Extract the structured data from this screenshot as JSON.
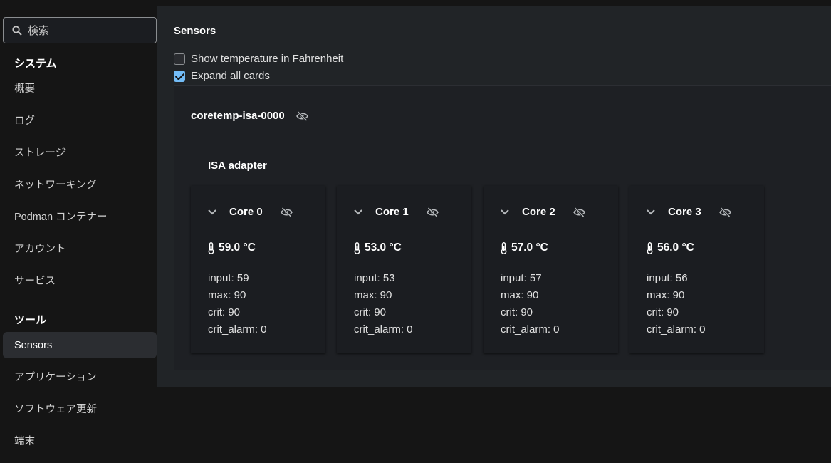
{
  "sidebar": {
    "search_placeholder": "検索",
    "sections": [
      {
        "heading": "システム",
        "items": [
          "概要",
          "ログ",
          "ストレージ",
          "ネットワーキング",
          "Podman コンテナー",
          "アカウント",
          "サービス"
        ]
      },
      {
        "heading": "ツール",
        "items": [
          "Sensors",
          "アプリケーション",
          "ソフトウェア更新",
          "端末"
        ]
      }
    ],
    "active_item": "Sensors"
  },
  "main": {
    "title": "Sensors",
    "options": [
      {
        "label": "Show temperature in Fahrenheit",
        "checked": false
      },
      {
        "label": "Expand all cards",
        "checked": true
      }
    ],
    "chip": {
      "name": "coretemp-isa-0000",
      "adapter": "ISA adapter",
      "cores": [
        {
          "name": "Core 0",
          "temp": "59.0 °C",
          "input": "input: 59",
          "max": "max: 90",
          "crit": "crit: 90",
          "crit_alarm": "crit_alarm: 0"
        },
        {
          "name": "Core 1",
          "temp": "53.0 °C",
          "input": "input: 53",
          "max": "max: 90",
          "crit": "crit: 90",
          "crit_alarm": "crit_alarm: 0"
        },
        {
          "name": "Core 2",
          "temp": "57.0 °C",
          "input": "input: 57",
          "max": "max: 90",
          "crit": "crit: 90",
          "crit_alarm": "crit_alarm: 0"
        },
        {
          "name": "Core 3",
          "temp": "56.0 °C",
          "input": "input: 56",
          "max": "max: 90",
          "crit": "crit: 90",
          "crit_alarm": "crit_alarm: 0"
        }
      ]
    }
  },
  "icons": {
    "search": "search-icon",
    "hide": "eye-slash-icon",
    "expand": "chevron-down-icon",
    "temperature": "thermometer-icon"
  },
  "colors": {
    "background": "#151515",
    "panel": "#212427",
    "card": "#1b1d21",
    "accent": "#73bcf7"
  }
}
